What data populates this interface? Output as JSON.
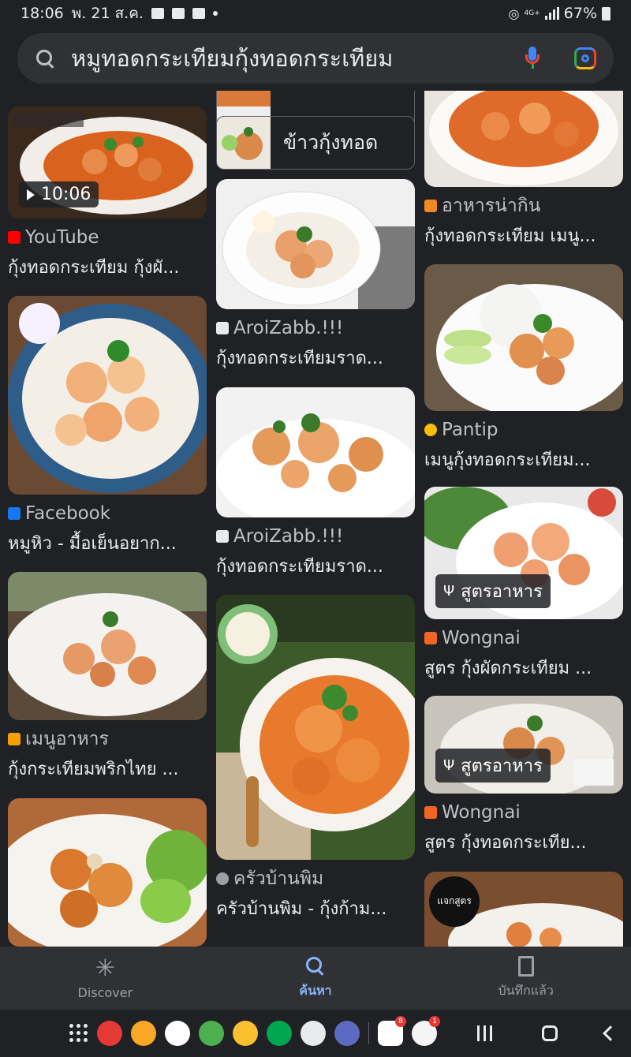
{
  "status_bar": {
    "time": "18:06",
    "date": "พ. 21 ส.ค.",
    "network": "4G+",
    "battery": "67%"
  },
  "search": {
    "query": "หมูทอดกระเทียมกุ้งทอดกระเทียม"
  },
  "chips": [
    {
      "label": ""
    },
    {
      "label": "ข้าวกุ้งทอด"
    }
  ],
  "results": {
    "col1": [
      {
        "source": "YouTube",
        "title": "กุ้งทอดกระเทียม กุ้งผั...",
        "badge": "10:06",
        "fav_color": "#ff0000"
      },
      {
        "source": "Facebook",
        "title": "หมูหิว - มื้อเย็นอยาก...",
        "fav_color": "#1877f2"
      },
      {
        "source": "เมนูอาหาร",
        "title": "กุ้งกระเทียมพริกไทย ...",
        "fav_color": "#f4a000"
      },
      {
        "source": "",
        "title": "",
        "fav_color": "#202124"
      }
    ],
    "col2": [
      {
        "source": "AroiZabb.!!!",
        "title": "กุ้งทอดกระเทียมราด...",
        "fav_color": "#e8eaed"
      },
      {
        "source": "AroiZabb.!!!",
        "title": "กุ้งทอดกระเทียมราด...",
        "fav_color": "#e8eaed"
      },
      {
        "source": "ครัวบ้านพิม",
        "title": "ครัวบ้านพิม - กุ้งก้าม...",
        "fav_color": "#9aa0a6"
      }
    ],
    "col3": [
      {
        "source": "อาหารน่ากิน",
        "title": "กุ้งทอดกระเทียม เมนู...",
        "fav_color": "#f08a24"
      },
      {
        "source": "Pantip",
        "title": "เมนูกุ้งทอดกระเทียม...",
        "fav_color": "#fbbc05"
      },
      {
        "source": "Wongnai",
        "title": "สูตร กุ้งผัดกระเทียม ...",
        "badge": "สูตรอาหาร",
        "fav_color": "#f26522"
      },
      {
        "source": "Wongnai",
        "title": "สูตร กุ้งทอดกระเทีย...",
        "badge": "สูตรอาหาร",
        "fav_color": "#f26522"
      },
      {
        "source": "",
        "title": "",
        "badge": "แจกสูตร",
        "fav_color": "#202124"
      }
    ]
  },
  "bottom_nav": {
    "discover": "Discover",
    "search": "ค้นหา",
    "saved": "บันทึกแล้ว"
  },
  "dock": {
    "youtube_badge": "8",
    "app_badge": "1"
  }
}
